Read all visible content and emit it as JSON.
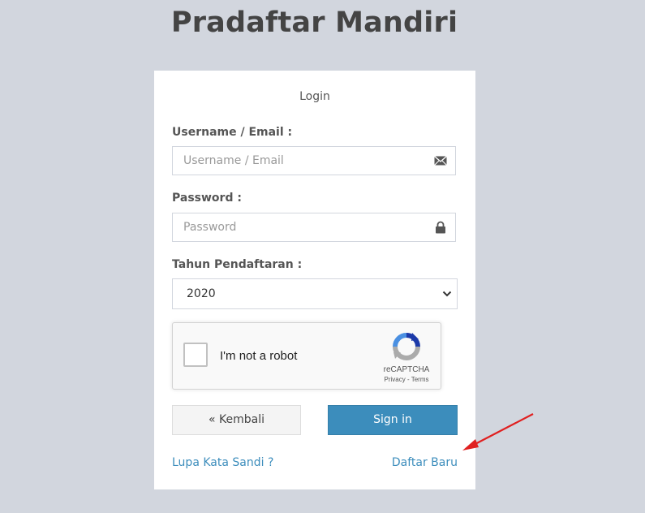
{
  "page": {
    "title": "Pradaftar Mandiri"
  },
  "login": {
    "box_title": "Login",
    "username": {
      "label": "Username / Email :",
      "placeholder": "Username / Email",
      "value": "",
      "icon": "envelope-icon"
    },
    "password": {
      "label": "Password :",
      "placeholder": "Password",
      "value": "",
      "icon": "lock-icon"
    },
    "year": {
      "label": "Tahun Pendaftaran :",
      "selected": "2020"
    },
    "recaptcha": {
      "checkbox_label": "I'm not a robot",
      "brand": "reCAPTCHA",
      "terms": "Privacy - Terms",
      "checked": false
    },
    "buttons": {
      "back": "« Kembali",
      "signin": "Sign in"
    },
    "links": {
      "forgot": "Lupa Kata Sandi ?",
      "register": "Daftar Baru"
    }
  },
  "colors": {
    "background": "#d2d6de",
    "primary": "#3c8dbc",
    "annotation_arrow": "#e02020"
  }
}
